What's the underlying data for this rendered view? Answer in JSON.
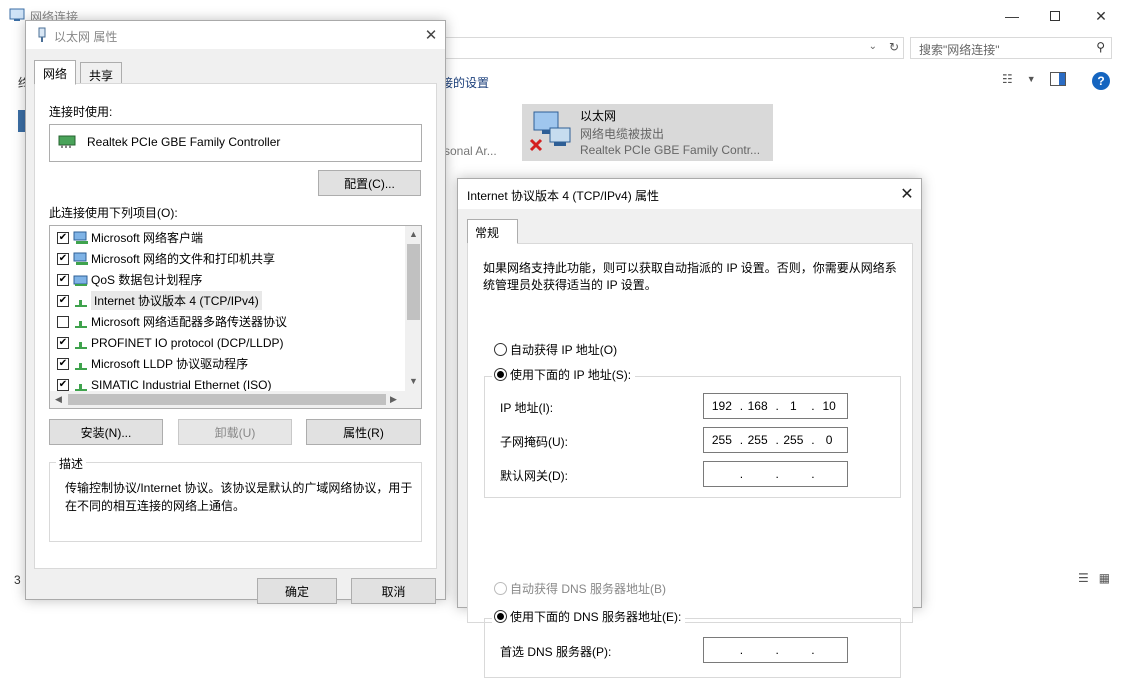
{
  "background": {
    "window_title": "网络连接",
    "search_placeholder": "搜索\"网络连接\"",
    "toolbar_link": "接的设置",
    "left_fragment": "终",
    "personal_fragment": "rsonal Ar...",
    "ethernet_tile": {
      "name": "以太网",
      "status": "网络电缆被拔出",
      "adapter": "Realtek PCIe GBE Family Contr..."
    },
    "status_left": "3"
  },
  "ethernet_dialog": {
    "title": "以太网 属性",
    "tabs": [
      "网络",
      "共享"
    ],
    "connect_using_label": "连接时使用:",
    "adapter_name": "Realtek PCIe GBE Family Controller",
    "configure_button": "配置(C)...",
    "items_label": "此连接使用下列项目(O):",
    "items": [
      {
        "label": "Microsoft 网络客户端",
        "checked": true,
        "icon": "network-client-icon"
      },
      {
        "label": "Microsoft 网络的文件和打印机共享",
        "checked": true,
        "icon": "file-share-icon"
      },
      {
        "label": "QoS 数据包计划程序",
        "checked": true,
        "icon": "qos-icon"
      },
      {
        "label": "Internet 协议版本 4 (TCP/IPv4)",
        "checked": true,
        "icon": "protocol-icon",
        "selected": true
      },
      {
        "label": "Microsoft 网络适配器多路传送器协议",
        "checked": false,
        "icon": "protocol-icon"
      },
      {
        "label": "PROFINET IO protocol (DCP/LLDP)",
        "checked": true,
        "icon": "protocol-icon"
      },
      {
        "label": "Microsoft LLDP 协议驱动程序",
        "checked": true,
        "icon": "protocol-icon"
      },
      {
        "label": "SIMATIC Industrial Ethernet (ISO)",
        "checked": true,
        "icon": "protocol-icon"
      }
    ],
    "install_button": "安装(N)...",
    "uninstall_button": "卸载(U)",
    "properties_button": "属性(R)",
    "description_label": "描述",
    "description_text": "传输控制协议/Internet 协议。该协议是默认的广域网络协议，用于在不同的相互连接的网络上通信。",
    "ok_button": "确定",
    "cancel_button": "取消"
  },
  "ipv4_dialog": {
    "title": "Internet 协议版本 4 (TCP/IPv4) 属性",
    "tab": "常规",
    "intro": "如果网络支持此功能，则可以获取自动指派的 IP 设置。否则，你需要从网络系统管理员处获得适当的 IP 设置。",
    "auto_ip_label": "自动获得 IP 地址(O)",
    "use_ip_label": "使用下面的 IP 地址(S):",
    "ip_mode": "manual",
    "ip_label": "IP 地址(I):",
    "ip_octets": [
      "192",
      "168",
      "1",
      "10"
    ],
    "mask_label": "子网掩码(U):",
    "mask_octets": [
      "255",
      "255",
      "255",
      "0"
    ],
    "gateway_label": "默认网关(D):",
    "gateway_octets": [
      "",
      "",
      "",
      ""
    ],
    "auto_dns_label": "自动获得 DNS 服务器地址(B)",
    "use_dns_label": "使用下面的 DNS 服务器地址(E):",
    "dns_mode": "manual",
    "preferred_dns_label": "首选 DNS 服务器(P):",
    "preferred_dns_octets": [
      "",
      "",
      "",
      ""
    ]
  }
}
